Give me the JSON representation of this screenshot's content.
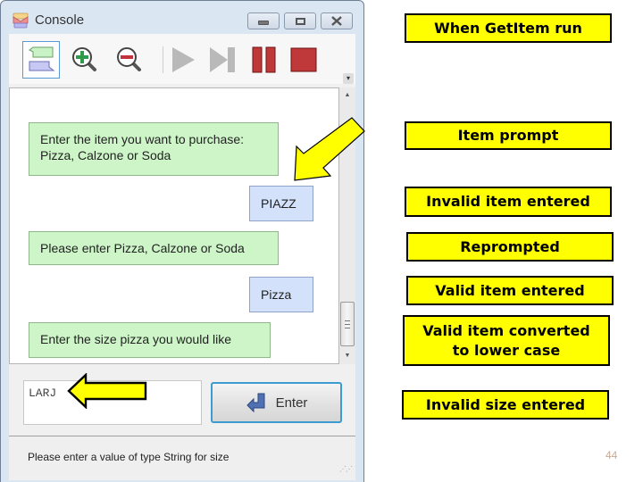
{
  "window": {
    "title": "Console",
    "title_icon": "console-icon",
    "controls": [
      "minimize",
      "maximize",
      "close"
    ]
  },
  "toolbar": {
    "tools": [
      {
        "name": "conversation-view",
        "icon": "speech-bubbles-icon",
        "selected": true
      },
      {
        "name": "zoom-in",
        "icon": "zoom-in-icon"
      },
      {
        "name": "zoom-out",
        "icon": "zoom-out-icon"
      },
      {
        "name": "run",
        "icon": "play-icon",
        "enabled": false
      },
      {
        "name": "step",
        "icon": "step-icon",
        "enabled": false
      },
      {
        "name": "pause",
        "icon": "pause-icon",
        "enabled": true
      },
      {
        "name": "stop",
        "icon": "stop-icon",
        "enabled": true
      }
    ]
  },
  "conversation": {
    "messages": [
      {
        "type": "prompt",
        "lines": [
          "Enter the item you want to purchase:",
          "Pizza, Calzone or Soda"
        ]
      },
      {
        "type": "reply",
        "text": "PIAZZ"
      },
      {
        "type": "prompt",
        "lines": [
          "Please enter Pizza, Calzone or Soda"
        ]
      },
      {
        "type": "reply",
        "text": "Pizza"
      },
      {
        "type": "prompt",
        "lines": [
          "Enter the size pizza you would like"
        ]
      }
    ]
  },
  "input": {
    "value": "LARJ",
    "enter_label": "Enter"
  },
  "status": {
    "text": "Please enter a value of type String for size"
  },
  "annotations": [
    {
      "text": "When GetItem run"
    },
    {
      "text": "Item prompt"
    },
    {
      "text": "Invalid item entered"
    },
    {
      "text": "Reprompted"
    },
    {
      "text": "Valid item entered"
    },
    {
      "text": "Valid item converted\nto lower case",
      "lines": [
        "Valid item converted",
        "to lower case"
      ]
    },
    {
      "text": "Invalid size entered"
    }
  ],
  "slide_number": "44",
  "colors": {
    "annotation_fill": "#ffff00",
    "prompt_bubble": "#cdf5c8",
    "reply_bubble": "#d3e1fa",
    "enter_focus": "#3c9bd1",
    "stop_red": "#c0393a"
  }
}
